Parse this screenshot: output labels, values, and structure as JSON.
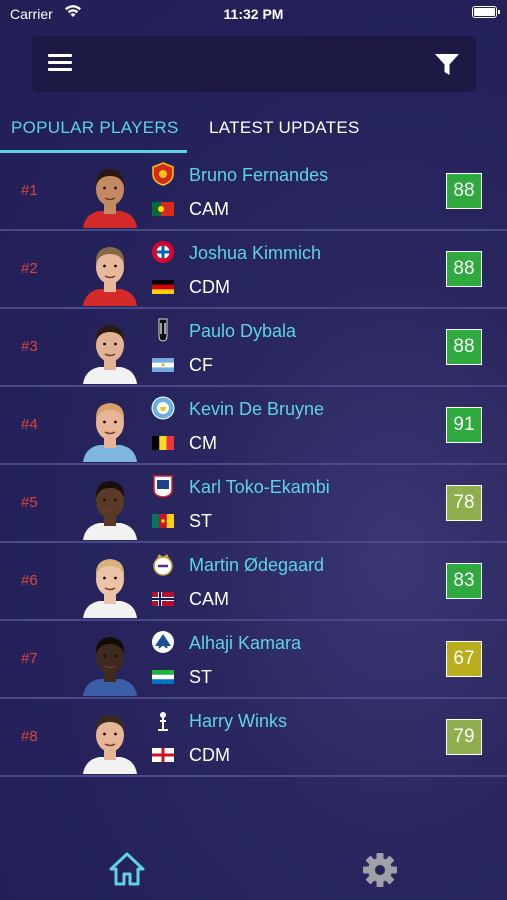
{
  "status_bar": {
    "carrier": "Carrier",
    "time": "11:32 PM"
  },
  "tabs": [
    {
      "label": "POPULAR PLAYERS",
      "active": true
    },
    {
      "label": "LATEST UPDATES",
      "active": false
    }
  ],
  "players": [
    {
      "rank": "#1",
      "name": "Bruno Fernandes",
      "position": "CAM",
      "rating": "88",
      "rating_color": "#2eaa3f",
      "club_icon": "manchester-united-crest",
      "flag": "portugal-flag",
      "skin": "#c48a63",
      "hair": "#2a1a12",
      "kit": "#d42a2a"
    },
    {
      "rank": "#2",
      "name": "Joshua Kimmich",
      "position": "CDM",
      "rating": "88",
      "rating_color": "#2eaa3f",
      "club_icon": "bayern-munich-crest",
      "flag": "germany-flag",
      "skin": "#e7b99a",
      "hair": "#8a6a44",
      "kit": "#d42a2a"
    },
    {
      "rank": "#3",
      "name": "Paulo Dybala",
      "position": "CF",
      "rating": "88",
      "rating_color": "#2eaa3f",
      "club_icon": "juventus-crest",
      "flag": "argentina-flag",
      "skin": "#e2b295",
      "hair": "#2a1c12",
      "kit": "#f2f2f2"
    },
    {
      "rank": "#4",
      "name": "Kevin De Bruyne",
      "position": "CM",
      "rating": "91",
      "rating_color": "#2eaa3f",
      "club_icon": "manchester-city-crest",
      "flag": "belgium-flag",
      "skin": "#e9b598",
      "hair": "#d9a06a",
      "kit": "#7fb6df"
    },
    {
      "rank": "#5",
      "name": "Karl Toko-Ekambi",
      "position": "ST",
      "rating": "78",
      "rating_color": "#8fae4e",
      "club_icon": "olympique-lyonnais-crest",
      "flag": "cameroon-flag",
      "skin": "#5a3a26",
      "hair": "#1a100a",
      "kit": "#f2f2f2"
    },
    {
      "rank": "#6",
      "name": "Martin Ødegaard",
      "position": "CAM",
      "rating": "83",
      "rating_color": "#2eaa3f",
      "club_icon": "real-madrid-crest",
      "flag": "norway-flag",
      "skin": "#ecc3a6",
      "hair": "#d6b27a",
      "kit": "#f2f2f2"
    },
    {
      "rank": "#7",
      "name": "Alhaji Kamara",
      "position": "ST",
      "rating": "67",
      "rating_color": "#b9ad1c",
      "club_icon": "randers-fc-crest",
      "flag": "sierra-leone-flag",
      "skin": "#3e2a1e",
      "hair": "#120c08",
      "kit": "#3a5fa6"
    },
    {
      "rank": "#8",
      "name": "Harry Winks",
      "position": "CDM",
      "rating": "79",
      "rating_color": "#8fae4e",
      "club_icon": "tottenham-hotspur-crest",
      "flag": "england-flag",
      "skin": "#e6b596",
      "hair": "#3a2a1c",
      "kit": "#f2f2f2"
    }
  ],
  "bottom_nav": [
    {
      "icon": "home-icon",
      "active": true,
      "color": "#5fd2e6"
    },
    {
      "icon": "gear-icon",
      "active": false,
      "color": "#a0a0a8"
    }
  ]
}
